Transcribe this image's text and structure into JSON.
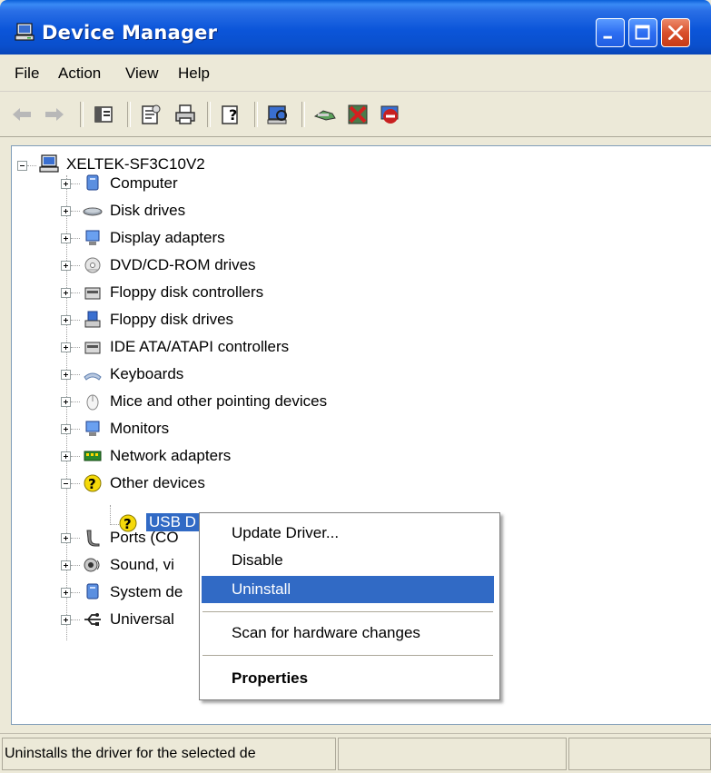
{
  "window": {
    "title": "Device Manager",
    "title_bar_color": "#0b55d9",
    "icon": "computer-monitor-icon"
  },
  "caption_buttons": {
    "minimize": "minimize-icon",
    "maximize": "maximize-icon",
    "close": "close-icon"
  },
  "menu": {
    "file": "File",
    "action": "Action",
    "view": "View",
    "help": "Help"
  },
  "toolbar": {
    "icons": [
      "back-arrow-icon",
      "forward-arrow-icon",
      "show-hide-console-tree-icon",
      "properties-icon",
      "print-icon",
      "help-icon",
      "scan-hardware-icon",
      "update-driver-icon",
      "uninstall-icon",
      "disable-icon"
    ]
  },
  "tree": {
    "root": "XELTEK-SF3C10V2",
    "categories": [
      {
        "label": "Computer",
        "icon": "computer-icon"
      },
      {
        "label": "Disk drives",
        "icon": "disk-drive-icon"
      },
      {
        "label": "Display adapters",
        "icon": "display-adapter-icon"
      },
      {
        "label": "DVD/CD-ROM drives",
        "icon": "dvd-drive-icon"
      },
      {
        "label": "Floppy disk controllers",
        "icon": "floppy-controller-icon"
      },
      {
        "label": "Floppy disk drives",
        "icon": "floppy-drive-icon"
      },
      {
        "label": "IDE ATA/ATAPI controllers",
        "icon": "ide-controller-icon"
      },
      {
        "label": "Keyboards",
        "icon": "keyboard-icon"
      },
      {
        "label": "Mice and other pointing devices",
        "icon": "mouse-icon"
      },
      {
        "label": "Monitors",
        "icon": "monitor-icon"
      },
      {
        "label": "Network adapters",
        "icon": "network-adapter-icon"
      },
      {
        "label": "Other devices",
        "icon": "unknown-device-icon"
      },
      {
        "label": "Ports (CO",
        "icon": "port-icon"
      },
      {
        "label": "Sound, vi",
        "icon": "sound-icon"
      },
      {
        "label": "System de",
        "icon": "system-device-icon"
      },
      {
        "label": "Universal",
        "icon": "usb-icon"
      }
    ],
    "selected_device": "USB D"
  },
  "context_menu": {
    "update_driver": "Update Driver...",
    "disable": "Disable",
    "uninstall": "Uninstall",
    "scan": "Scan for hardware changes",
    "properties": "Properties",
    "highlight_color": "#316ac5"
  },
  "status": {
    "text": "Uninstalls the driver for the selected de"
  }
}
